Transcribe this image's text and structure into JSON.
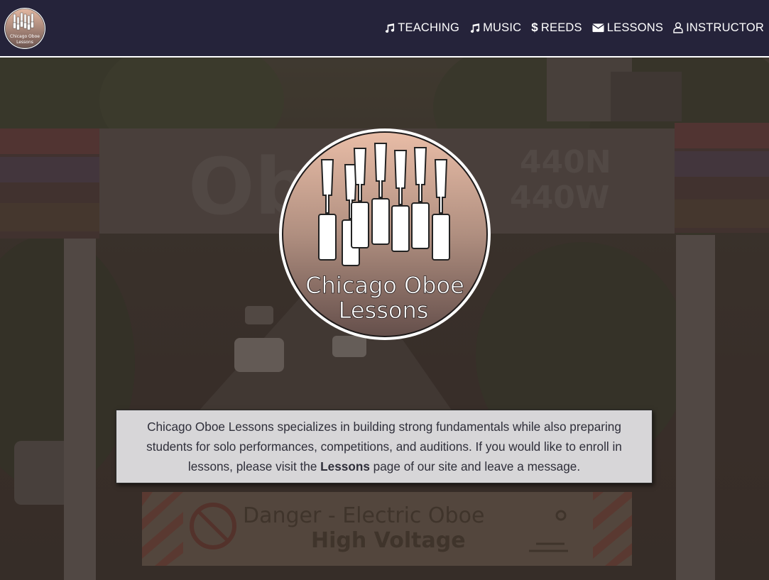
{
  "brand": {
    "logo_line1": "Chicago Oboe",
    "logo_line2": "Lessons"
  },
  "nav": {
    "items": [
      {
        "label": "TEACHING",
        "icon": "music-note-icon"
      },
      {
        "label": "MUSIC",
        "icon": "music-note-icon"
      },
      {
        "label": "REEDS",
        "icon": "dollar-icon"
      },
      {
        "label": "LESSONS",
        "icon": "envelope-icon"
      },
      {
        "label": "INSTRUCTOR",
        "icon": "user-icon"
      }
    ]
  },
  "hero": {
    "sign_word": "Ob",
    "sign_code1": "440N",
    "sign_code2": "440W",
    "danger_line1": "Danger -  Electric Oboe",
    "danger_line2": "High Voltage",
    "logo_line1": "Chicago Oboe",
    "logo_line2": "Lessons"
  },
  "intro": {
    "text_before": "Chicago Oboe Lessons specializes in building strong fundamentals while also preparing students for solo performances, competitions, and auditions. If you would like to enroll in lessons, please visit the ",
    "link": "Lessons",
    "text_after": " page of our site and leave a message."
  },
  "colors": {
    "navbar": "#25233a",
    "logo_gradient_top": "#e3b8a2",
    "logo_gradient_bottom": "#6e5651",
    "card": "#d7d6d8"
  }
}
